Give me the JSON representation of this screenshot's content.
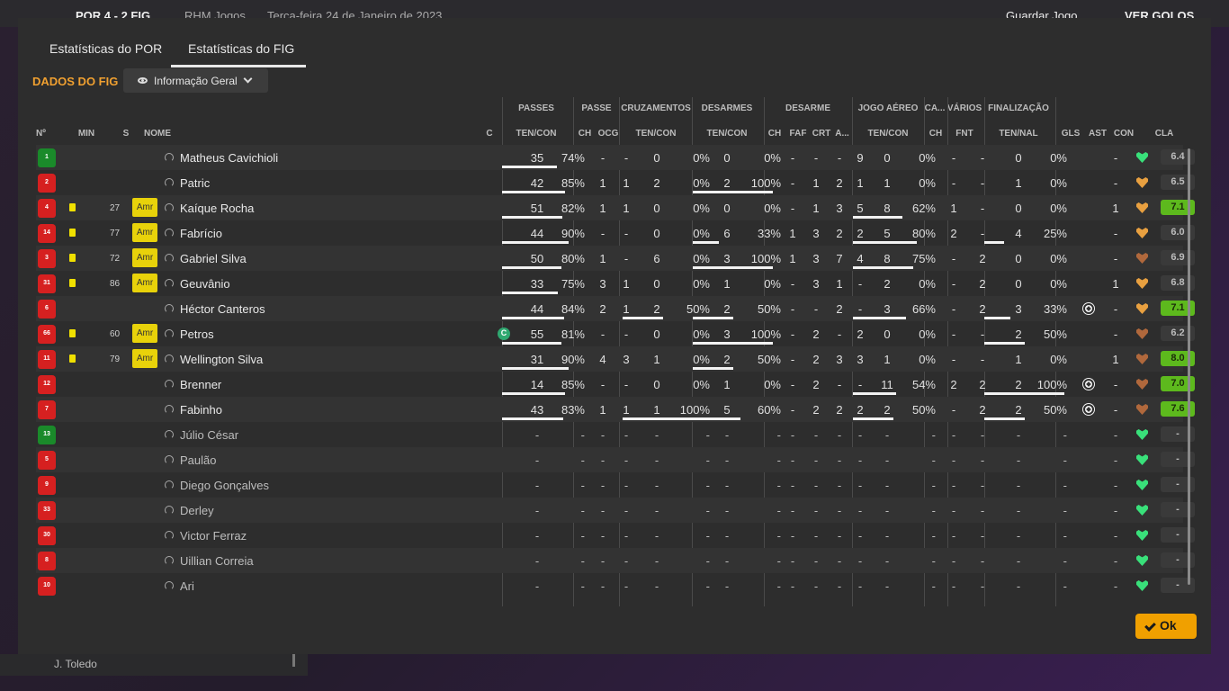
{
  "background": {
    "match_info": "POR 4 - 2 FIG",
    "channel": "RHM Jogos",
    "date": "Terça-feira 24 de Janeiro de 2023",
    "save_button": "Guardar Jogo",
    "goals_button": "VER GOLOS",
    "sidebar_player": "J. Toledo"
  },
  "tabs": [
    {
      "label": "Estatísticas do POR",
      "active": false
    },
    {
      "label": "Estatísticas do FIG",
      "active": true
    }
  ],
  "section_title": "DADOS DO FIG",
  "view_dropdown": {
    "label": "Informação Geral",
    "icon": "eye-icon"
  },
  "groups": [
    "PASSES",
    "PASSE",
    "CRUZAMENTOS",
    "DESARMES",
    "DESARME",
    "JOGO AÉREO",
    "CA...",
    "VÁRIOS",
    "FINALIZAÇÃO"
  ],
  "columns": [
    "Nº",
    "MIN",
    "S",
    "NOME",
    "C",
    "TEN/CON",
    "CH",
    "OCG",
    "TEN/CON",
    "TEN/CON",
    "CH",
    "FAF",
    "CRT",
    "A...",
    "TEN/CON",
    "CH",
    "FNT",
    "TEN/NAL",
    "GLS",
    "AST",
    "CON",
    "CLA"
  ],
  "colors": {
    "accent": "#f0a030",
    "rating_good": "#5db91d",
    "shirt_red": "#d62020",
    "shirt_gk": "#1a8a2a",
    "card_yellow": "#f0e000",
    "ok_button": "#f0a000"
  },
  "rows": [
    {
      "num": "1",
      "gk": true,
      "card": false,
      "min": "",
      "sub": "",
      "name": "Matheus Cavichioli",
      "captain": false,
      "passes": [
        "35",
        "74%"
      ],
      "passes_pct": 74,
      "ch": "-",
      "ocg": "-",
      "cruz": [
        "0",
        "0%"
      ],
      "cruz_pct": 0,
      "des": [
        "0",
        "0%"
      ],
      "des_pct": 0,
      "dch": "-",
      "faf": "-",
      "crt": "-",
      "a": "9",
      "aer": [
        "0",
        "0%"
      ],
      "aer_pct": 0,
      "ca": "-",
      "fnt": "-",
      "fin": [
        "0",
        "0%"
      ],
      "fin_pct": 0,
      "gls": 0,
      "ast": "-",
      "con": "green",
      "cla": "6.4",
      "cla_good": false
    },
    {
      "num": "2",
      "gk": false,
      "card": false,
      "min": "",
      "sub": "",
      "name": "Patric",
      "captain": false,
      "passes": [
        "42",
        "85%"
      ],
      "passes_pct": 85,
      "ch": "1",
      "ocg": "1",
      "cruz": [
        "2",
        "0%"
      ],
      "cruz_pct": 0,
      "des": [
        "2",
        "100%"
      ],
      "des_pct": 100,
      "dch": "-",
      "faf": "1",
      "crt": "2",
      "a": "1",
      "aer": [
        "1",
        "0%"
      ],
      "aer_pct": 0,
      "ca": "-",
      "fnt": "-",
      "fin": [
        "1",
        "0%"
      ],
      "fin_pct": 0,
      "gls": 0,
      "ast": "-",
      "con": "orange",
      "cla": "6.5",
      "cla_good": false
    },
    {
      "num": "4",
      "gk": false,
      "card": true,
      "min": "27",
      "sub": "Amr",
      "name": "Kaíque Rocha",
      "captain": false,
      "passes": [
        "51",
        "82%"
      ],
      "passes_pct": 82,
      "ch": "1",
      "ocg": "1",
      "cruz": [
        "0",
        "0%"
      ],
      "cruz_pct": 0,
      "des": [
        "0",
        "0%"
      ],
      "des_pct": 0,
      "dch": "-",
      "faf": "1",
      "crt": "3",
      "a": "5",
      "aer": [
        "8",
        "62%"
      ],
      "aer_pct": 62,
      "ca": "1",
      "fnt": "-",
      "fin": [
        "0",
        "0%"
      ],
      "fin_pct": 0,
      "gls": 0,
      "ast": "1",
      "con": "orange",
      "cla": "7.1",
      "cla_good": true
    },
    {
      "num": "14",
      "gk": false,
      "card": true,
      "min": "77",
      "sub": "Amr",
      "name": "Fabrício",
      "captain": false,
      "passes": [
        "44",
        "90%"
      ],
      "passes_pct": 90,
      "ch": "-",
      "ocg": "-",
      "cruz": [
        "0",
        "0%"
      ],
      "cruz_pct": 0,
      "des": [
        "6",
        "33%"
      ],
      "des_pct": 33,
      "dch": "1",
      "faf": "3",
      "crt": "2",
      "a": "2",
      "aer": [
        "5",
        "80%"
      ],
      "aer_pct": 80,
      "ca": "2",
      "fnt": "-",
      "fin": [
        "4",
        "25%"
      ],
      "fin_pct": 25,
      "gls": 0,
      "ast": "-",
      "con": "orange",
      "cla": "6.0",
      "cla_good": false
    },
    {
      "num": "3",
      "gk": false,
      "card": true,
      "min": "72",
      "sub": "Amr",
      "name": "Gabriel Silva",
      "captain": false,
      "passes": [
        "50",
        "80%"
      ],
      "passes_pct": 80,
      "ch": "1",
      "ocg": "-",
      "cruz": [
        "6",
        "0%"
      ],
      "cruz_pct": 0,
      "des": [
        "3",
        "100%"
      ],
      "des_pct": 100,
      "dch": "1",
      "faf": "3",
      "crt": "7",
      "a": "4",
      "aer": [
        "8",
        "75%"
      ],
      "aer_pct": 75,
      "ca": "-",
      "fnt": "2",
      "fin": [
        "0",
        "0%"
      ],
      "fin_pct": 0,
      "gls": 0,
      "ast": "-",
      "con": "brown",
      "cla": "6.9",
      "cla_good": false
    },
    {
      "num": "31",
      "gk": false,
      "card": true,
      "min": "86",
      "sub": "Amr",
      "name": "Geuvânio",
      "captain": false,
      "passes": [
        "33",
        "75%"
      ],
      "passes_pct": 75,
      "ch": "3",
      "ocg": "1",
      "cruz": [
        "0",
        "0%"
      ],
      "cruz_pct": 0,
      "des": [
        "1",
        "0%"
      ],
      "des_pct": 0,
      "dch": "-",
      "faf": "3",
      "crt": "1",
      "a": "-",
      "aer": [
        "2",
        "0%"
      ],
      "aer_pct": 0,
      "ca": "-",
      "fnt": "2",
      "fin": [
        "0",
        "0%"
      ],
      "fin_pct": 0,
      "gls": 0,
      "ast": "1",
      "con": "orange",
      "cla": "6.8",
      "cla_good": false
    },
    {
      "num": "6",
      "gk": false,
      "card": false,
      "min": "",
      "sub": "",
      "name": "Héctor Canteros",
      "captain": false,
      "passes": [
        "44",
        "84%"
      ],
      "passes_pct": 84,
      "ch": "2",
      "ocg": "1",
      "cruz": [
        "2",
        "50%"
      ],
      "cruz_pct": 50,
      "des": [
        "2",
        "50%"
      ],
      "des_pct": 50,
      "dch": "-",
      "faf": "-",
      "crt": "2",
      "a": "-",
      "aer": [
        "3",
        "66%"
      ],
      "aer_pct": 66,
      "ca": "-",
      "fnt": "2",
      "fin": [
        "3",
        "33%"
      ],
      "fin_pct": 33,
      "gls": 1,
      "ast": "-",
      "con": "orange",
      "cla": "7.1",
      "cla_good": true
    },
    {
      "num": "66",
      "gk": false,
      "card": true,
      "min": "60",
      "sub": "Amr",
      "name": "Petros",
      "captain": true,
      "passes": [
        "55",
        "81%"
      ],
      "passes_pct": 81,
      "ch": "-",
      "ocg": "-",
      "cruz": [
        "0",
        "0%"
      ],
      "cruz_pct": 0,
      "des": [
        "3",
        "100%"
      ],
      "des_pct": 100,
      "dch": "-",
      "faf": "2",
      "crt": "-",
      "a": "2",
      "aer": [
        "0",
        "0%"
      ],
      "aer_pct": 0,
      "ca": "-",
      "fnt": "-",
      "fin": [
        "2",
        "50%"
      ],
      "fin_pct": 50,
      "gls": 0,
      "ast": "-",
      "con": "brown",
      "cla": "6.2",
      "cla_good": false
    },
    {
      "num": "11",
      "gk": false,
      "card": true,
      "min": "79",
      "sub": "Amr",
      "name": "Wellington Silva",
      "captain": false,
      "passes": [
        "31",
        "90%"
      ],
      "passes_pct": 90,
      "ch": "4",
      "ocg": "3",
      "cruz": [
        "1",
        "0%"
      ],
      "cruz_pct": 0,
      "des": [
        "2",
        "50%"
      ],
      "des_pct": 50,
      "dch": "-",
      "faf": "2",
      "crt": "3",
      "a": "3",
      "aer": [
        "1",
        "0%"
      ],
      "aer_pct": 0,
      "ca": "-",
      "fnt": "-",
      "fin": [
        "1",
        "0%"
      ],
      "fin_pct": 0,
      "gls": 0,
      "ast": "1",
      "con": "brown",
      "cla": "8.0",
      "cla_good": true
    },
    {
      "num": "12",
      "gk": false,
      "card": false,
      "min": "",
      "sub": "",
      "name": "Brenner",
      "captain": false,
      "passes": [
        "14",
        "85%"
      ],
      "passes_pct": 85,
      "ch": "-",
      "ocg": "-",
      "cruz": [
        "0",
        "0%"
      ],
      "cruz_pct": 0,
      "des": [
        "1",
        "0%"
      ],
      "des_pct": 0,
      "dch": "-",
      "faf": "2",
      "crt": "-",
      "a": "-",
      "aer": [
        "11",
        "54%"
      ],
      "aer_pct": 54,
      "ca": "2",
      "fnt": "2",
      "fin": [
        "2",
        "100%"
      ],
      "fin_pct": 100,
      "gls": 1,
      "ast": "-",
      "con": "brown",
      "cla": "7.0",
      "cla_good": true
    },
    {
      "num": "7",
      "gk": false,
      "card": false,
      "min": "",
      "sub": "",
      "name": "Fabinho",
      "captain": false,
      "passes": [
        "43",
        "83%"
      ],
      "passes_pct": 83,
      "ch": "1",
      "ocg": "1",
      "cruz": [
        "1",
        "100%"
      ],
      "cruz_pct": 100,
      "des": [
        "5",
        "60%"
      ],
      "des_pct": 60,
      "dch": "-",
      "faf": "2",
      "crt": "2",
      "a": "2",
      "aer": [
        "2",
        "50%"
      ],
      "aer_pct": 50,
      "ca": "-",
      "fnt": "2",
      "fin": [
        "2",
        "50%"
      ],
      "fin_pct": 50,
      "gls": 1,
      "ast": "-",
      "con": "brown",
      "cla": "7.6",
      "cla_good": true
    },
    {
      "num": "13",
      "gk": true,
      "unused": true,
      "name": "Júlio César"
    },
    {
      "num": "5",
      "gk": false,
      "unused": true,
      "name": "Paulão"
    },
    {
      "num": "9",
      "gk": false,
      "unused": true,
      "name": "Diego Gonçalves"
    },
    {
      "num": "33",
      "gk": false,
      "unused": true,
      "name": "Derley"
    },
    {
      "num": "30",
      "gk": false,
      "unused": true,
      "name": "Victor Ferraz"
    },
    {
      "num": "8",
      "gk": false,
      "unused": true,
      "name": "Uillian Correia"
    },
    {
      "num": "10",
      "gk": false,
      "unused": true,
      "name": "Ari"
    }
  ],
  "ok_button": "Ok",
  "captain_badge": "C",
  "empty": "-"
}
